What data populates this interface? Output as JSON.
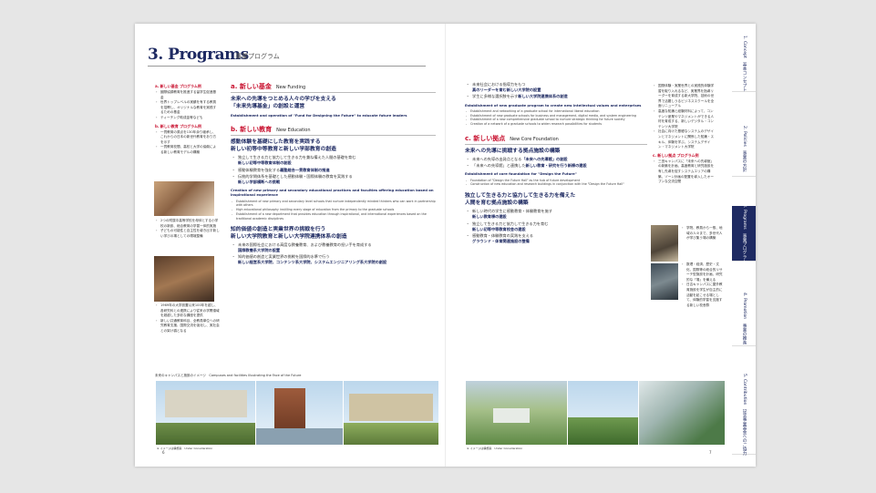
{
  "header": {
    "title": "3. Programs",
    "subtitle": "事業プログラム"
  },
  "left_sidebar": {
    "a_head": "a. 新しい基金 プログラム例",
    "a_items": [
      "國際協調教育を推進する留学生促進基金",
      "世界トップレベルの実績を有する教員を招聘し、オリジナルな教育を実践するための基金",
      "ティーチング助成金等なども"
    ],
    "b_head": "b. 新しい教育 プログラム例",
    "b_items": [
      "一貫教育の原点を130年余り継承し、これからの日本の新世代教育をあり方を示す",
      "一貫教育校間、高校と大学の協働による新しい教育モデルの構築"
    ],
    "b2_items": [
      "2つの附属中高等学校を母体とする小学校の新設、総合教育の学習一体的実施",
      "子どもの可能性と自主性を導き出す新しい学びの場としての環境整備"
    ],
    "b3_items": [
      "1969年の大学設置以来100年を越し、各研究科との連携により従来の学問領域を超越した多彩な講座を提供",
      "新しい共通教育科目、全教員単位への研究教育支援、国際交流を強化し、実社会との架け橋となる"
    ]
  },
  "sec_a": {
    "label": "a. 新しい基金",
    "en": "New Funding",
    "lead1": "未来への先導をつとめる人々の学びを支える",
    "lead2": "「未来先導基金」の創設と運営",
    "en_desc": "Establishment and operation of \"Fund for Designing the Future\" to educate future leaders"
  },
  "sec_b": {
    "label": "b. 新しい教育",
    "en": "New Education",
    "lead1": "感動体験を基礎にした教育を実践する",
    "lead2": "新しい初等中等教育と新しい学部教育の創造",
    "items": [
      {
        "t": "独立して生きる力と協力して生きる力を兼ね備えた人間の基礎を育む",
        "b": "新しい初等中等教育体制の創設"
      },
      {
        "t": "感動体験教育を強化する",
        "b": "義塾総合一貫教育体制の推進"
      },
      {
        "t": "伝統的学問体系を基礎とした感動体験・国際体験の教育を実践する",
        "b": "新しい学部横断への挑戦"
      }
    ],
    "en_desc": "Creation of new primary and secondary educational practices and faculties offering education based on inspirational experience",
    "en_items": [
      "Establishment of new primary and secondary level schools that nurture independently minded thinkers who can work in partnership with others",
      "High educational philosophy instilling every stage of education from the primary to the graduate schools",
      "Establishment of a new department that provides education through inspirational, and international experiences based on the traditional academic disciplines"
    ],
    "lead3": "知的価値の創造と実業世界の挑戦を行う",
    "lead4": "新しい大学院教育と新しい大学院連携体系の創造",
    "items2": [
      {
        "t": "未来の国際社会における高度な教養教育、および教養教育の担い手を育成する",
        "b": "国際教養系大学院の設置"
      },
      {
        "t": "知的価値の創造と実業世界の挑戦を国際的水準で行う",
        "b": "新しい経営系大学院、コンテンツ系大学院、システムエンジニアリング系大学院の創設"
      }
    ]
  },
  "right_top": {
    "items": [
      {
        "t": "未来社会における指導力をもつ",
        "b": "真のリーダーを育む新しい大学院の設置"
      },
      {
        "t": "学生に多様な選択肢を示す",
        "b": "新しい大学院連携体系の創造"
      }
    ],
    "en_desc": "Establishment of new graduate program to create new intellectual values and enterprises",
    "en_items": [
      "Establishment and networking of a graduate school for international liberal education",
      "Establishment of new graduate schools for business and management, digital media, and system engineering",
      "Establishment of a new comprehensive graduate school to nurture strategic thinking for future society",
      "Creation of a network of a graduate schools to widen research possibilities for students"
    ]
  },
  "sec_c": {
    "label": "c. 新しい拠点",
    "en": "New Core Foundation",
    "lead1": "未来への先導に挑戦する拠点施設の構築",
    "items": [
      {
        "t": "未来への先導の出発点となる",
        "b": "「未来への先導館」の創設"
      },
      {
        "t": "「未来への先導館」と連携した",
        "b": "新しい教育・研究を行う新棟の建設"
      }
    ],
    "en_desc": "Establishment of core foundation for \"Design the Future\"",
    "en_items": [
      "Foundation of \"Design the Future Hall\" as the hub of future development",
      "Construction of new education and research buildings in conjunction with the \"Design the Future Hall\""
    ],
    "lead2": "独立して生きる力と協力して生きる力を備えた",
    "lead3": "人間を育む拠点施設の構築",
    "items2": [
      {
        "t": "新しい時代の学生に感動教育・体験教育を施す",
        "b": "新しい教育棟の建設"
      },
      {
        "t": "独立して生きる力と協力して生きる力を育む",
        "b": "新しい初等中等教育校舎の建設"
      },
      {
        "t": "感動教育・体験教育の実践を支える",
        "b": "グラウンド・体育関連施設の整備"
      }
    ]
  },
  "right_sidebar": {
    "items": [
      "国際体験・実業世界との実践的体験学習を取り入れるなど、実業界を指導リーダーを育成する新大学院、技術の世界で活躍しうるビジネススクールを全面リニューアル",
      "高度な知識と経験材料によって、コンテンツ産業やマネジメントができる人材を育成する、新しいデジタル・コンテンツ大学院",
      "社会に向けた基礎なシステムのデザインとマネジメントに関係した知識・スキル、体験を学ぶ、システムデザイン・マネジメント大学院"
    ],
    "c_head": "c. 新しい拠点 プログラム例",
    "c_items": [
      "三田キャンパスに「未来への先導館」の新築を計画、高度教育と研究施設を有し先導を促すシステムエリアの構築、ゾーン計画の配置を導入したオープンな交流空間"
    ],
    "c_items2": [
      "学院、教員から一般、地域の人々まで、多世代人が学び集う場の構築"
    ],
    "c_items3": [
      "数理・経済、歴史・文化、国際等の総合的リサーチ型施設を計画、研究的な「場」を備える",
      "日吉キャンパスに屋外教育施設を学生が自主的に活動を起こせる場として、体験的学習を支援する新しい校舎群"
    ]
  },
  "bottom": {
    "caption_left": "未来のキャンパスと施設のイメージ　Campuses and facilities Illustrating the Face of the Future",
    "credit": "※ イメージは構想案　Under Consideration"
  },
  "pages": {
    "left": "6",
    "right": "7"
  },
  "tabs": [
    "1. Concept　基本コンセプト",
    "2. Policies　事業の方針",
    "3. Programs　事業プログラム",
    "4. Promotion　事業の推進",
    "5. Contribution　記念事業基金へのご協力"
  ]
}
